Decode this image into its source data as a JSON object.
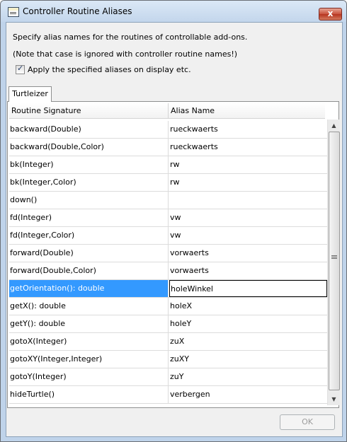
{
  "window": {
    "title": "Controller Routine Aliases",
    "close_label": "x"
  },
  "description": {
    "line1": "Specify alias names for the routines of controllable add-ons.",
    "line2": "(Note that case is ignored with controller routine names!)"
  },
  "apply_option": {
    "label": "Apply the specified aliases on display etc.",
    "checked": true
  },
  "tabs": [
    {
      "label": "Turtleizer",
      "active": true
    }
  ],
  "table": {
    "columns": [
      "Routine Signature",
      "Alias Name"
    ],
    "rows": [
      {
        "signature": "backward(Double)",
        "alias": "rueckwaerts"
      },
      {
        "signature": "backward(Double,Color)",
        "alias": "rueckwaerts"
      },
      {
        "signature": "bk(Integer)",
        "alias": "rw"
      },
      {
        "signature": "bk(Integer,Color)",
        "alias": "rw"
      },
      {
        "signature": "down()",
        "alias": ""
      },
      {
        "signature": "fd(Integer)",
        "alias": "vw"
      },
      {
        "signature": "fd(Integer,Color)",
        "alias": "vw"
      },
      {
        "signature": "forward(Double)",
        "alias": "vorwaerts"
      },
      {
        "signature": "forward(Double,Color)",
        "alias": "vorwaerts"
      },
      {
        "signature": "getOrientation(): double",
        "alias": "holeWinkel",
        "selected": true
      },
      {
        "signature": "getX(): double",
        "alias": "holeX"
      },
      {
        "signature": "getY(): double",
        "alias": "holeY"
      },
      {
        "signature": "gotoX(Integer)",
        "alias": "zuX"
      },
      {
        "signature": "gotoXY(Integer,Integer)",
        "alias": "zuXY"
      },
      {
        "signature": "gotoY(Integer)",
        "alias": "zuY"
      },
      {
        "signature": "hideTurtle()",
        "alias": "verbergen"
      }
    ]
  },
  "footer": {
    "ok_label": "OK",
    "ok_enabled": false
  },
  "colors": {
    "selection": "#3399ff",
    "window_frame": "#bfd3ea",
    "close_button": "#c9513c"
  },
  "icons": {
    "app": "app-window-icon",
    "close": "close-icon",
    "scroll_up": "scroll-up-arrow-icon",
    "scroll_down": "scroll-down-arrow-icon",
    "thumb_grip": "scroll-grip-icon",
    "check": "checkmark-icon"
  }
}
